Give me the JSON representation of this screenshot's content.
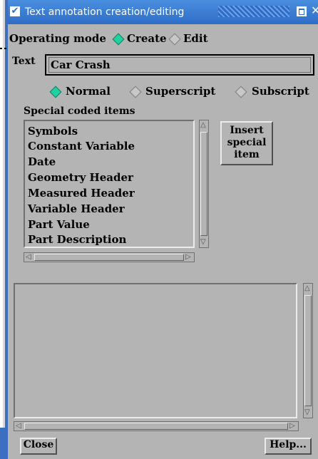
{
  "window": {
    "title": "Text annotation creation/editing"
  },
  "mode": {
    "label": "Operating mode",
    "options": [
      "Create",
      "Edit"
    ],
    "selected": "Create"
  },
  "text": {
    "label": "Text",
    "value": "Car Crash"
  },
  "script_options": {
    "options": [
      "Normal",
      "Superscript",
      "Subscript"
    ],
    "selected": "Normal"
  },
  "special": {
    "label": "Special coded items",
    "items": [
      "Symbols",
      "Constant Variable",
      "Date",
      "Geometry Header",
      "Measured Header",
      "Variable Header",
      "Part Value",
      "Part Description"
    ],
    "insert_button": [
      "Insert",
      "special",
      "item"
    ]
  },
  "footer": {
    "close_label": "Close",
    "help_label": "Help..."
  },
  "colors": {
    "titlebar": "#2f6cc6",
    "background": "#b4b4b4",
    "radio_on": "#22d0a0"
  }
}
